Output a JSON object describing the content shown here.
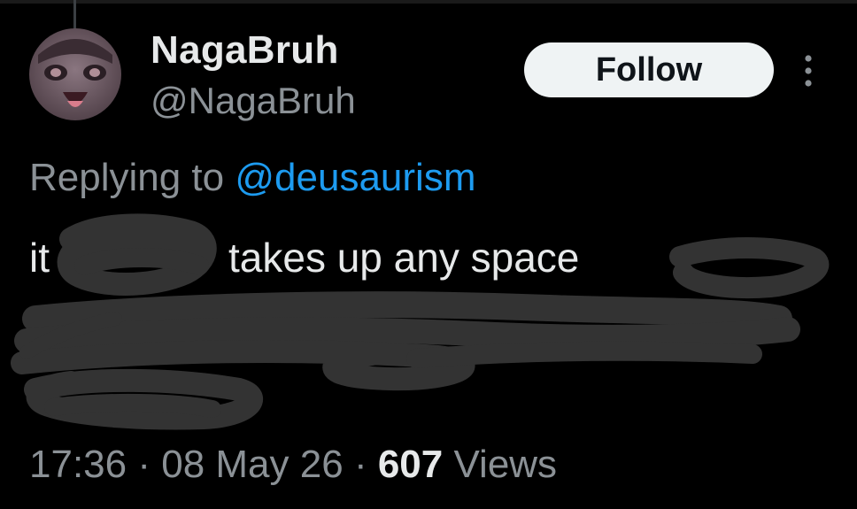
{
  "user": {
    "display_name": "NagaBruh",
    "handle": "@NagaBruh"
  },
  "actions": {
    "follow_label": "Follow",
    "more_icon": "more-vertical-icon"
  },
  "reply": {
    "prefix": "Replying to",
    "target": "@deusaurism"
  },
  "tweet": {
    "visible_text_start": "it",
    "visible_text_rest": "takes up any space"
  },
  "meta": {
    "time": "17:36",
    "separator_1": "·",
    "date": "08 May 26",
    "separator_2": "·",
    "views_count": "607",
    "views_label": "Views"
  },
  "colors": {
    "background": "#000000",
    "text_primary": "#e7e9ea",
    "text_secondary": "#8b9196",
    "link": "#1d9bf0",
    "follow_bg": "#eff3f4",
    "scribble": "#333333"
  }
}
